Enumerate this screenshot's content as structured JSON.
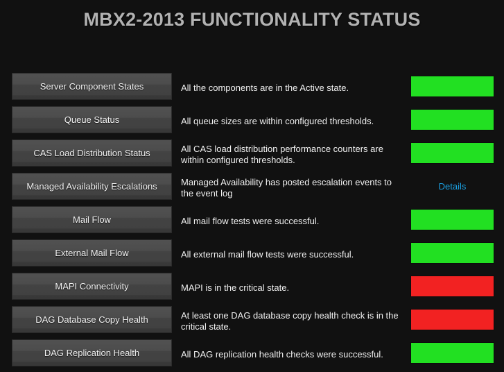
{
  "header": {
    "title": "MBX2-2013 FUNCTIONALITY STATUS"
  },
  "colors": {
    "background": "#111111",
    "title_text": "#b2b2b2",
    "body_text": "#f0f0f0",
    "healthy": "#22e022",
    "critical": "#f22222",
    "link": "#1ba1e2",
    "button_top": "#4f4f4f",
    "button_bottom": "#383838"
  },
  "rows": [
    {
      "name": "Server Component States",
      "description": "All the components are in the Active state.",
      "status_kind": "green",
      "status_label": ""
    },
    {
      "name": "Queue Status",
      "description": "All queue sizes are within configured thresholds.",
      "status_kind": "green",
      "status_label": ""
    },
    {
      "name": "CAS Load Distribution Status",
      "description": "All CAS load distribution performance counters are within configured thresholds.",
      "status_kind": "green",
      "status_label": ""
    },
    {
      "name": "Managed Availability Escalations",
      "description": "Managed Availability has posted escalation events to the event log",
      "status_kind": "link",
      "status_label": "Details"
    },
    {
      "name": "Mail Flow",
      "description": "All mail flow tests were successful.",
      "status_kind": "green",
      "status_label": ""
    },
    {
      "name": "External Mail Flow",
      "description": "All external mail flow tests were successful.",
      "status_kind": "green",
      "status_label": ""
    },
    {
      "name": "MAPI Connectivity",
      "description": "MAPI is in the critical state.",
      "status_kind": "red",
      "status_label": ""
    },
    {
      "name": "DAG Database Copy Health",
      "description": "At least one DAG database copy health check is in the critical state.",
      "status_kind": "red",
      "status_label": ""
    },
    {
      "name": "DAG Replication Health",
      "description": "All DAG replication health checks were successful.",
      "status_kind": "green",
      "status_label": ""
    }
  ]
}
